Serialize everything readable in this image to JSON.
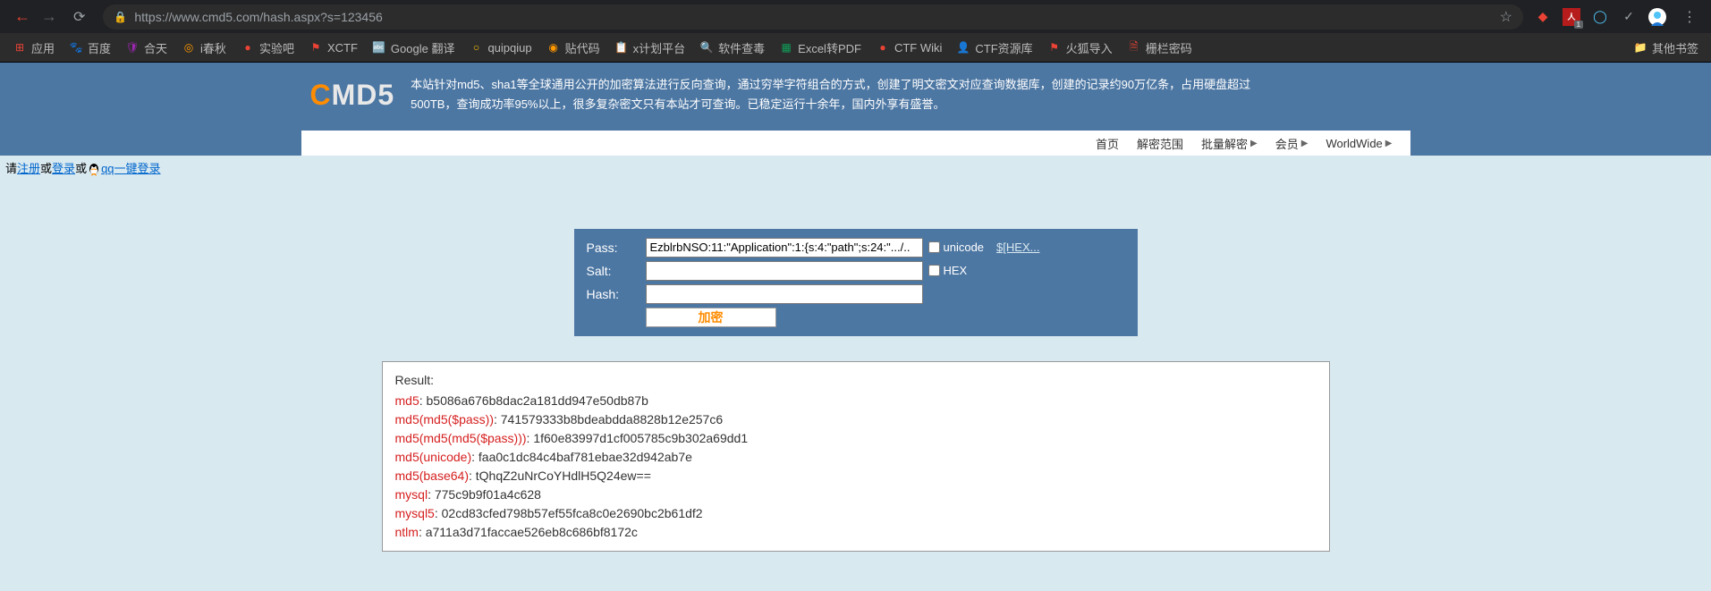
{
  "browser": {
    "url": "https://www.cmd5.com/hash.aspx?s=123456",
    "ext_badge": "1"
  },
  "bookmarks": [
    {
      "label": "应用",
      "color": "red"
    },
    {
      "label": "百度",
      "color": "blue"
    },
    {
      "label": "合天",
      "color": "purple"
    },
    {
      "label": "i春秋",
      "color": "orange"
    },
    {
      "label": "实验吧",
      "color": "red"
    },
    {
      "label": "XCTF",
      "color": "red"
    },
    {
      "label": "Google 翻译",
      "color": "blue"
    },
    {
      "label": "quipqiup",
      "color": "yellow"
    },
    {
      "label": "贴代码",
      "color": "orange"
    },
    {
      "label": "x计划平台",
      "color": "red"
    },
    {
      "label": "软件查毒",
      "color": "orange"
    },
    {
      "label": "Excel转PDF",
      "color": "green"
    },
    {
      "label": "CTF Wiki",
      "color": "red"
    },
    {
      "label": "CTF资源库",
      "color": "yellow"
    },
    {
      "label": "火狐导入",
      "color": "red"
    },
    {
      "label": "栅栏密码",
      "color": "red"
    }
  ],
  "bookmark_other": "其他书签",
  "header": {
    "logo_c": "C",
    "logo_rest": "MD5",
    "desc": "本站针对md5、sha1等全球通用公开的加密算法进行反向查询，通过穷举字符组合的方式，创建了明文密文对应查询数据库，创建的记录约90万亿条，占用硬盘超过500TB，查询成功率95%以上，很多复杂密文只有本站才可查询。已稳定运行十余年，国内外享有盛誉。"
  },
  "nav": {
    "home": "首页",
    "scope": "解密范围",
    "batch": "批量解密",
    "member": "会员",
    "world": "WorldWide"
  },
  "login": {
    "prefix": "请",
    "register": "注册",
    "or1": "或",
    "login": "登录",
    "or2": "或",
    "qq": "qq一键登录"
  },
  "form": {
    "pass_label": "Pass:",
    "salt_label": "Salt:",
    "hash_label": "Hash:",
    "pass_value": "EzblrbNSO:11:\"Application\":1:{s:4:\"path\";s:24:\".../..",
    "salt_value": "",
    "hash_value": "",
    "unicode_label": "unicode",
    "hex_label": "HEX",
    "hex_link": "$[HEX...",
    "encrypt_btn": "加密"
  },
  "result": {
    "title": "Result:",
    "lines": [
      {
        "name": "md5",
        "val": "b5086a676b8dac2a181dd947e50db87b"
      },
      {
        "name": "md5(md5($pass))",
        "val": "741579333b8bdeabdda8828b12e257c6"
      },
      {
        "name": "md5(md5(md5($pass)))",
        "val": "1f60e83997d1cf005785c9b302a69dd1"
      },
      {
        "name": "md5(unicode)",
        "val": "faa0c1dc84c4baf781ebae32d942ab7e"
      },
      {
        "name": "md5(base64)",
        "val": "tQhqZ2uNrCoYHdlH5Q24ew=="
      },
      {
        "name": "mysql",
        "val": "775c9b9f01a4c628"
      },
      {
        "name": "mysql5",
        "val": "02cd83cfed798b57ef55fca8c0e2690bc2b61df2"
      },
      {
        "name": "ntlm",
        "val": "a711a3d71faccae526eb8c686bf8172c"
      }
    ]
  }
}
